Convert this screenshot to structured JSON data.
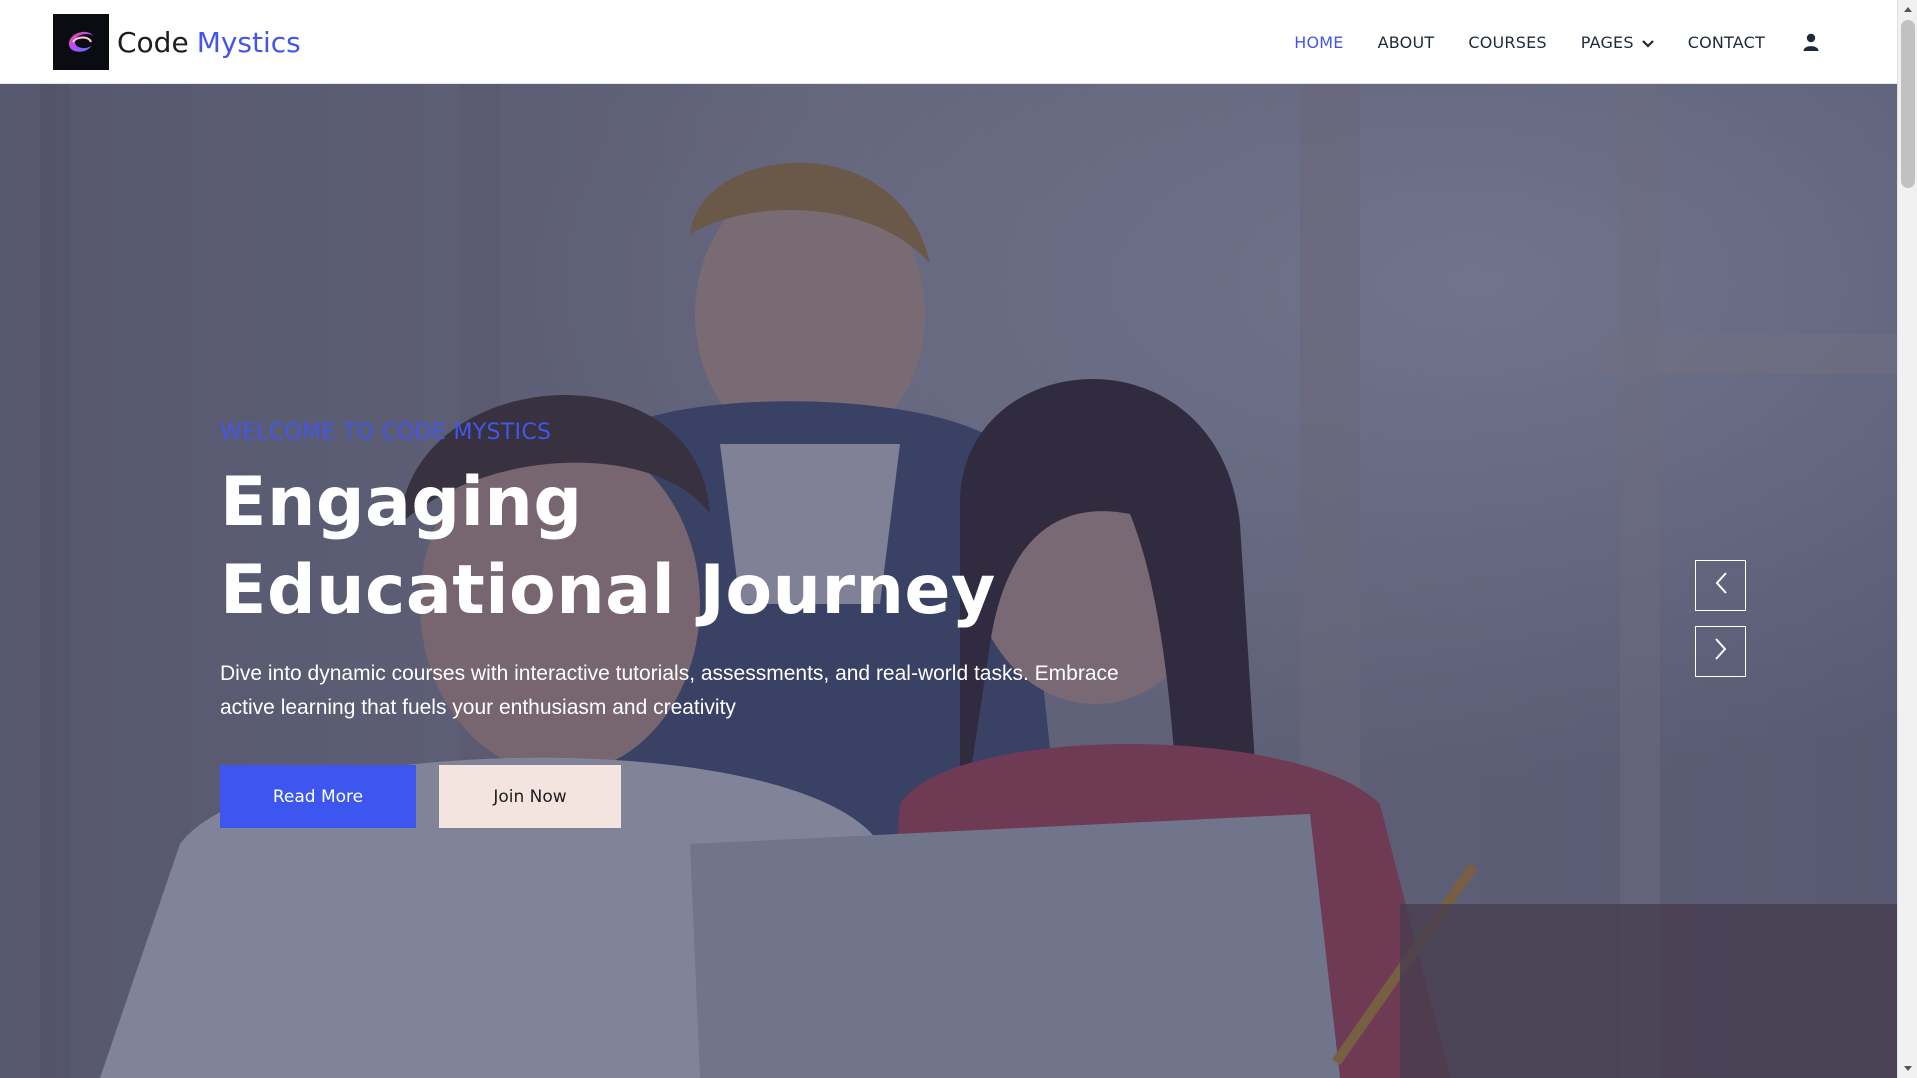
{
  "brand": {
    "name_primary": "Code",
    "name_accent": "Mystics"
  },
  "nav": {
    "items": [
      {
        "label": "HOME"
      },
      {
        "label": "ABOUT"
      },
      {
        "label": "COURSES"
      },
      {
        "label": "PAGES"
      },
      {
        "label": "CONTACT"
      }
    ],
    "active": "HOME"
  },
  "hero": {
    "eyebrow": "WELCOME TO CODE MYSTICS",
    "headline": "Engaging Educational Journey",
    "description": "Dive into dynamic courses with interactive tutorials, assessments, and real-world tasks. Embrace active learning that fuels your enthusiasm and creativity",
    "primary_button": "Read More",
    "secondary_button": "Join Now"
  },
  "colors": {
    "accent": "#4456e8",
    "primary_button": "#3d56f0",
    "secondary_button": "#f3e4df",
    "hero_overlay": "#2a2f55"
  },
  "icons": {
    "user": "user-icon",
    "dropdown": "chevron-down-icon",
    "carousel_prev": "chevron-left-icon",
    "carousel_next": "chevron-right-icon"
  }
}
